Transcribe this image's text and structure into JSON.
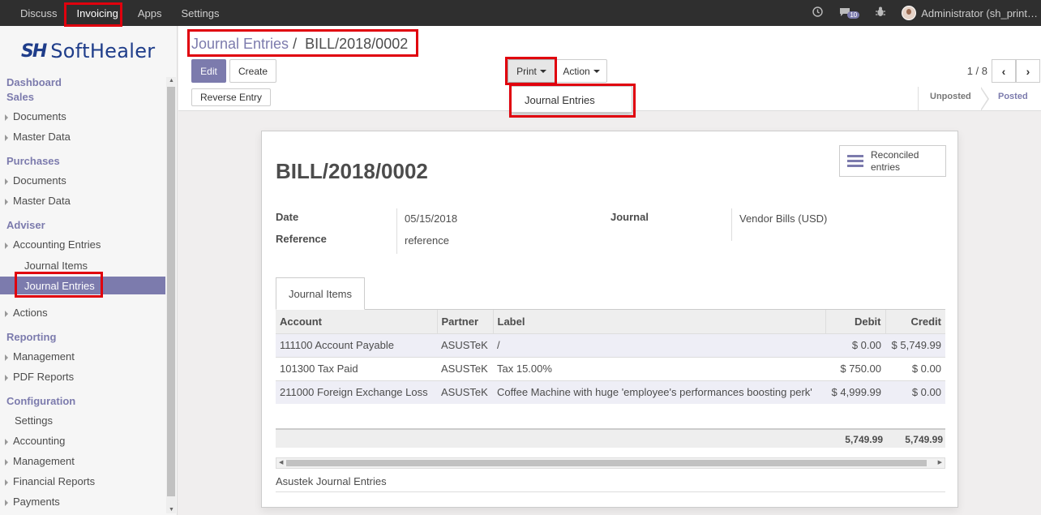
{
  "topbar": {
    "menu": [
      "Discuss",
      "Invoicing",
      "Apps",
      "Settings"
    ],
    "active": "Invoicing",
    "notification_count": "10",
    "user": "Administrator (sh_print…"
  },
  "brand": {
    "mark": "SH",
    "name": "SoftHealer"
  },
  "sidebar": {
    "sections": [
      {
        "title": "Dashboard"
      },
      {
        "title": "Sales",
        "items": [
          "Documents",
          "Master Data"
        ]
      },
      {
        "title": "Purchases",
        "items": [
          "Documents",
          "Master Data"
        ]
      },
      {
        "title": "Adviser",
        "items": [
          "Accounting Entries"
        ],
        "subitems": [
          "Journal Items",
          "Journal Entries"
        ],
        "items_after": [
          "Actions"
        ]
      },
      {
        "title": "Reporting",
        "items": [
          "Management",
          "PDF Reports"
        ]
      },
      {
        "title": "Configuration",
        "items": [
          "Settings",
          "Accounting",
          "Management",
          "Financial Reports",
          "Payments"
        ]
      }
    ],
    "selected": "Journal Entries"
  },
  "breadcrumb": {
    "parent": "Journal Entries",
    "separator": "/",
    "current": "BILL/2018/0002"
  },
  "buttons": {
    "edit": "Edit",
    "create": "Create",
    "print": "Print",
    "action": "Action",
    "reverse": "Reverse Entry"
  },
  "print_menu": {
    "items": [
      "Journal Entries"
    ]
  },
  "pager": {
    "value": "1 / 8",
    "prev": "‹",
    "next": "›"
  },
  "statusbar": {
    "unposted": "Unposted",
    "posted": "Posted",
    "current": "Posted"
  },
  "record": {
    "name": "BILL/2018/0002",
    "smart_button": {
      "line1": "Reconciled",
      "line2": "entries"
    },
    "date_label": "Date",
    "date": "05/15/2018",
    "reference_label": "Reference",
    "reference": "reference",
    "journal_label": "Journal",
    "journal": "Vendor Bills (USD)"
  },
  "tab": "Journal Items",
  "table": {
    "columns": [
      "Account",
      "Partner",
      "Label",
      "Debit",
      "Credit"
    ],
    "rows": [
      [
        "111100 Account Payable",
        "ASUSTeK",
        "/",
        "$ 0.00",
        "$ 5,749.99"
      ],
      [
        "101300 Tax Paid",
        "ASUSTeK",
        "Tax 15.00%",
        "$ 750.00",
        "$ 0.00"
      ],
      [
        "211000 Foreign Exchange Loss",
        "ASUSTeK",
        "Coffee Machine with huge 'employee's performances boosting perk'",
        "$ 4,999.99",
        "$ 0.00"
      ]
    ],
    "totals": {
      "debit": "5,749.99",
      "credit": "5,749.99"
    }
  },
  "note": "Asustek Journal Entries",
  "colors": {
    "accent": "#7c7bad",
    "highlight": "#e0000d",
    "navbar": "#2f2f2f"
  }
}
